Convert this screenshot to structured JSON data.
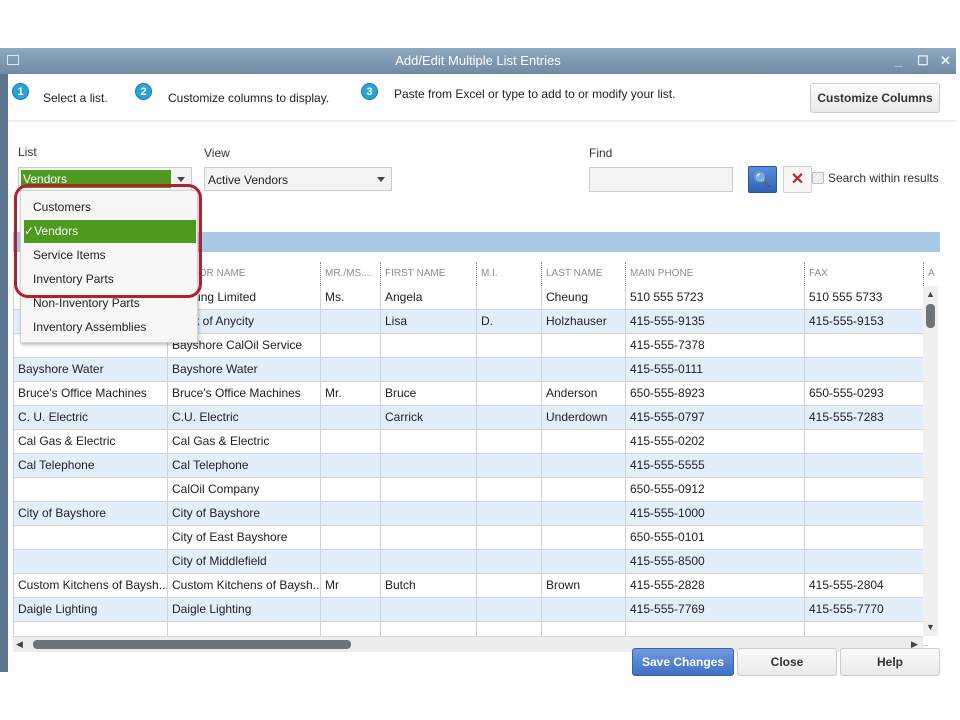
{
  "window": {
    "title": "Add/Edit Multiple List Entries",
    "controls": [
      "_",
      "☐",
      "✕"
    ]
  },
  "steps": [
    {
      "num": "1",
      "text": "Select a list."
    },
    {
      "num": "2",
      "text": "Customize columns to display."
    },
    {
      "num": "3",
      "text": "Paste from Excel or type to add to or modify your list."
    }
  ],
  "customize_columns_label": "Customize Columns",
  "list": {
    "label": "List",
    "value": "Vendors",
    "options": [
      "Customers",
      "Vendors",
      "Service Items",
      "Inventory Parts",
      "Non-Inventory Parts",
      "Inventory Assemblies"
    ],
    "selected": "Vendors"
  },
  "view": {
    "label": "View",
    "value": "Active Vendors"
  },
  "find": {
    "label": "Find",
    "value": "",
    "search_within_label": "Search within results",
    "search_within_checked": false
  },
  "colors": {
    "accent_green": "#4e9a1e",
    "highlight_red": "#b3202a",
    "primary_blue": "#4a78c8"
  },
  "table": {
    "columns": [
      "",
      "VENDOR NAME",
      "MR./MS....",
      "FIRST NAME",
      "M.I.",
      "LAST NAME",
      "MAIN PHONE",
      "FAX",
      "A"
    ],
    "rows": [
      [
        "",
        "Cheung Limited",
        "Ms.",
        "Angela",
        "",
        "Cheung",
        "510 555 5723",
        "510 555 5733"
      ],
      [
        "",
        "Bank of Anycity",
        "",
        "Lisa",
        "D.",
        "Holzhauser",
        "415-555-9135",
        "415-555-9153"
      ],
      [
        "",
        "Bayshore CalOil Service",
        "",
        "",
        "",
        "",
        "415-555-7378",
        ""
      ],
      [
        "Bayshore Water",
        "Bayshore Water",
        "",
        "",
        "",
        "",
        "415-555-0111",
        ""
      ],
      [
        "Bruce's Office Machines",
        "Bruce's Office Machines",
        "Mr.",
        "Bruce",
        "",
        "Anderson",
        "650-555-8923",
        "650-555-0293"
      ],
      [
        "C. U. Electric",
        "C.U. Electric",
        "",
        "Carrick",
        "",
        "Underdown",
        "415-555-0797",
        "415-555-7283"
      ],
      [
        "Cal Gas & Electric",
        "Cal Gas & Electric",
        "",
        "",
        "",
        "",
        "415-555-0202",
        ""
      ],
      [
        "Cal Telephone",
        "Cal Telephone",
        "",
        "",
        "",
        "",
        "415-555-5555",
        ""
      ],
      [
        "",
        "CalOil Company",
        "",
        "",
        "",
        "",
        "650-555-0912",
        ""
      ],
      [
        "City of Bayshore",
        "City of Bayshore",
        "",
        "",
        "",
        "",
        "415-555-1000",
        ""
      ],
      [
        "",
        "City of East Bayshore",
        "",
        "",
        "",
        "",
        "650-555-0101",
        ""
      ],
      [
        "",
        "City of Middlefield",
        "",
        "",
        "",
        "",
        "415-555-8500",
        ""
      ],
      [
        "Custom Kitchens of Baysh...",
        "Custom Kitchens of Baysh...",
        "Mr",
        "Butch",
        "",
        "Brown",
        "415-555-2828",
        "415-555-2804"
      ],
      [
        "Daigle Lighting",
        "Daigle Lighting",
        "",
        "",
        "",
        "",
        "415-555-7769",
        "415-555-7770"
      ],
      [
        "",
        "",
        "",
        "",
        "",
        "",
        "",
        ""
      ]
    ]
  },
  "buttons": {
    "save": "Save Changes",
    "close": "Close",
    "help": "Help"
  }
}
